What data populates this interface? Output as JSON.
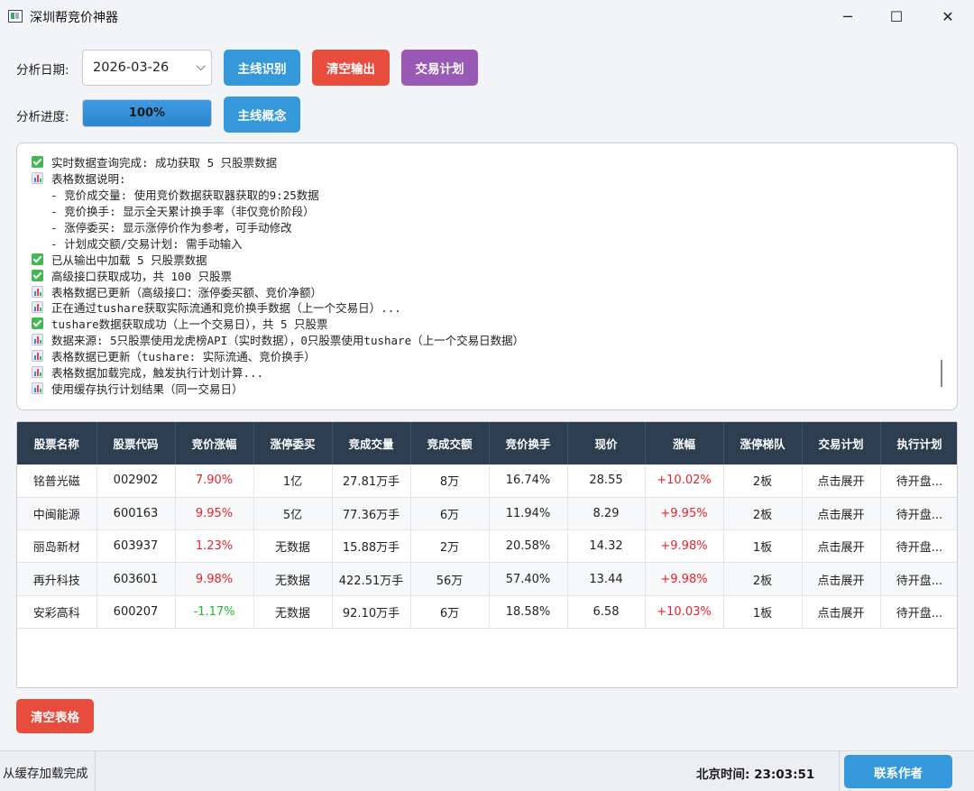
{
  "window": {
    "title": "深圳帮竞价神器",
    "minimize_glyph": "─",
    "maximize_glyph": "☐",
    "close_glyph": "✕"
  },
  "controls": {
    "date_label": "分析日期:",
    "date_value": "2026-03-26",
    "progress_label": "分析进度:",
    "progress_percent": 100,
    "progress_text": "100%",
    "btn_mainline": "主线识别",
    "btn_clear_output": "清空输出",
    "btn_trade_plan": "交易计划",
    "btn_mainline_concept": "主线概念"
  },
  "colors": {
    "blue": "#3498db",
    "red": "#e74c3c",
    "purple": "#9b59b6",
    "header": "#2c3e50",
    "up": "#e5252a",
    "down": "#1fb82f"
  },
  "log": [
    {
      "icon": "check",
      "text": "实时数据查询完成: 成功获取 5 只股票数据"
    },
    {
      "icon": "chart",
      "text": "表格数据说明:"
    },
    {
      "icon": "none",
      "text": "  - 竞价成交量: 使用竞价数据获取器获取的9:25数据"
    },
    {
      "icon": "none",
      "text": "  - 竞价换手: 显示全天累计换手率（非仅竞价阶段）"
    },
    {
      "icon": "none",
      "text": "  - 涨停委买: 显示涨停价作为参考，可手动修改"
    },
    {
      "icon": "none",
      "text": "  - 计划成交额/交易计划: 需手动输入"
    },
    {
      "icon": "check",
      "text": "已从输出中加载 5 只股票数据"
    },
    {
      "icon": "check",
      "text": "高级接口获取成功，共 100 只股票"
    },
    {
      "icon": "chart",
      "text": "表格数据已更新（高级接口：涨停委买额、竞价净额）"
    },
    {
      "icon": "chart",
      "text": "正在通过tushare获取实际流通和竞价换手数据（上一个交易日）..."
    },
    {
      "icon": "check",
      "text": "tushare数据获取成功（上一个交易日），共 5 只股票"
    },
    {
      "icon": "chart",
      "text": "数据来源: 5只股票使用龙虎榜API（实时数据），0只股票使用tushare（上一个交易日数据）"
    },
    {
      "icon": "chart",
      "text": "表格数据已更新（tushare: 实际流通、竞价换手）"
    },
    {
      "icon": "chart",
      "text": "表格数据加载完成，触发执行计划计算..."
    },
    {
      "icon": "chart",
      "text": "使用缓存执行计划结果（同一交易日）"
    }
  ],
  "table": {
    "headers": [
      "股票名称",
      "股票代码",
      "竞价涨幅",
      "涨停委买",
      "竞成交量",
      "竞成交额",
      "竞价换手",
      "现价",
      "涨幅",
      "涨停梯队",
      "交易计划",
      "执行计划"
    ],
    "rows": [
      {
        "cells": [
          "铭普光磁",
          "002902",
          "7.90%",
          "1亿",
          "27.81万手",
          "8万",
          "16.74%",
          "28.55",
          "+10.02%",
          "2板",
          "点击展开",
          "待开盘..."
        ],
        "bid_dir": "up",
        "chg_dir": "up"
      },
      {
        "cells": [
          "中闽能源",
          "600163",
          "9.95%",
          "5亿",
          "77.36万手",
          "6万",
          "11.94%",
          "8.29",
          "+9.95%",
          "2板",
          "点击展开",
          "待开盘..."
        ],
        "bid_dir": "up",
        "chg_dir": "up"
      },
      {
        "cells": [
          "丽岛新材",
          "603937",
          "1.23%",
          "无数据",
          "15.88万手",
          "2万",
          "20.58%",
          "14.32",
          "+9.98%",
          "1板",
          "点击展开",
          "待开盘..."
        ],
        "bid_dir": "up",
        "chg_dir": "up"
      },
      {
        "cells": [
          "再升科技",
          "603601",
          "9.98%",
          "无数据",
          "422.51万手",
          "56万",
          "57.40%",
          "13.44",
          "+9.98%",
          "2板",
          "点击展开",
          "待开盘..."
        ],
        "bid_dir": "up",
        "chg_dir": "up"
      },
      {
        "cells": [
          "安彩高科",
          "600207",
          "-1.17%",
          "无数据",
          "92.10万手",
          "6万",
          "18.58%",
          "6.58",
          "+10.03%",
          "1板",
          "点击展开",
          "待开盘..."
        ],
        "bid_dir": "down",
        "chg_dir": "up"
      }
    ]
  },
  "bottom": {
    "btn_clear_table": "清空表格",
    "status_text": "从缓存加载完成",
    "clock_text": "北京时间: 23:03:51",
    "btn_contact": "联系作者"
  }
}
